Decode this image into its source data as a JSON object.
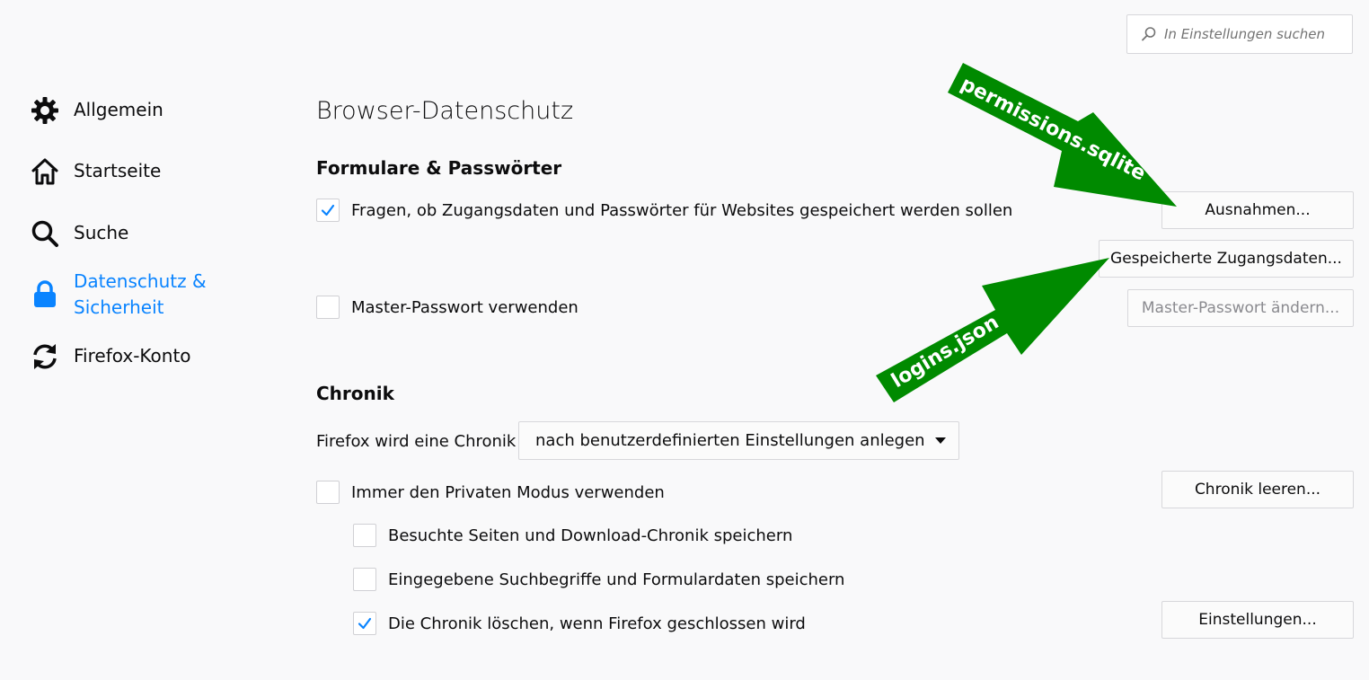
{
  "search": {
    "placeholder": "In Einstellungen suchen",
    "icon": "search-icon"
  },
  "sidebar": {
    "items": [
      {
        "label": "Allgemein",
        "icon": "gear-icon"
      },
      {
        "label": "Startseite",
        "icon": "home-icon"
      },
      {
        "label": "Suche",
        "icon": "search-icon"
      },
      {
        "label": "Datenschutz &\nSicherheit",
        "icon": "lock-icon",
        "active": true
      },
      {
        "label": "Firefox-Konto",
        "icon": "sync-icon"
      }
    ]
  },
  "main": {
    "title": "Browser-Datenschutz",
    "forms_section": {
      "heading": "Formulare & Passwörter",
      "ask_save_logins": {
        "label": "Fragen, ob Zugangsdaten und Passwörter für Websites gespeichert werden sollen",
        "checked": true
      },
      "master_password": {
        "label": "Master-Passwort verwenden",
        "checked": false
      },
      "exceptions_button": "Ausnahmen...",
      "saved_logins_button": "Gespeicherte Zugangsdaten...",
      "change_master_button": "Master-Passwort ändern..."
    },
    "history_section": {
      "heading": "Chronik",
      "mode_label": "Firefox wird eine Chronik",
      "mode_value": "nach benutzerdefinierten Einstellungen anlegen",
      "private_mode": {
        "label": "Immer den Privaten Modus verwenden",
        "checked": false
      },
      "remember_history": {
        "label": "Besuchte Seiten und Download-Chronik speichern",
        "checked": false
      },
      "remember_forms": {
        "label": "Eingegebene Suchbegriffe und Formulardaten speichern",
        "checked": false
      },
      "clear_on_close": {
        "label": "Die Chronik löschen, wenn Firefox geschlossen wird",
        "checked": true
      },
      "clear_history_button": "Chronik leeren...",
      "settings_button": "Einstellungen..."
    }
  },
  "annotations": {
    "arrow_top_label": "permissions.sqlite",
    "arrow_bottom_label": "logins.json",
    "arrow_color": "#008a00"
  },
  "colors": {
    "accent": "#0a84ff",
    "checkmark": "#0a84ff",
    "background": "#f9f9fa"
  }
}
